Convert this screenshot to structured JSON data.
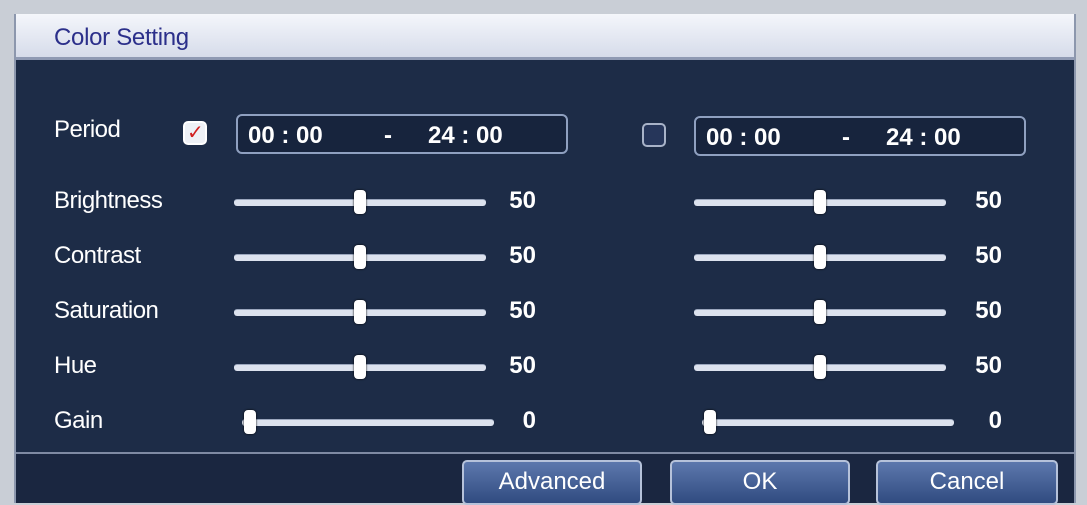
{
  "window": {
    "title": "Color Setting"
  },
  "labels": {
    "period": "Period",
    "brightness": "Brightness",
    "contrast": "Contrast",
    "saturation": "Saturation",
    "hue": "Hue",
    "gain": "Gain"
  },
  "period1": {
    "checked": true,
    "start": "00 : 00",
    "separator": "-",
    "end": "24 : 00"
  },
  "period2": {
    "checked": false,
    "start": "00 : 00",
    "separator": "-",
    "end": "24 : 00"
  },
  "values1": {
    "brightness": "50",
    "contrast": "50",
    "saturation": "50",
    "hue": "50",
    "gain": "0"
  },
  "values2": {
    "brightness": "50",
    "contrast": "50",
    "saturation": "50",
    "hue": "50",
    "gain": "0"
  },
  "slider_range": {
    "min": 0,
    "max": 100
  },
  "buttons": {
    "advanced": "Advanced",
    "ok": "OK",
    "cancel": "Cancel"
  },
  "icons": {
    "checked_mark": "checkmark-icon"
  },
  "colors": {
    "panel": "#1d2c47",
    "title_text": "#2b2f8a",
    "checkmark": "#d12020",
    "button": "#3f5c95"
  }
}
